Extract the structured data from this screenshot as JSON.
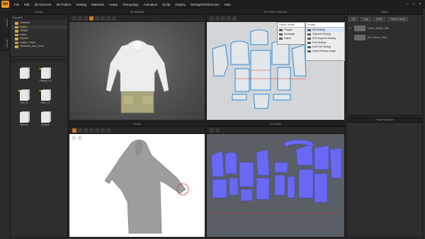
{
  "app": {
    "logo_text": "Md"
  },
  "menu": [
    "File",
    "Edit",
    "3D Garment",
    "2D Pattern",
    "Sewing",
    "Materials",
    "Avatar",
    "Retopology",
    "Animation",
    "Script",
    "Display",
    "Settings/Preferences",
    "Help"
  ],
  "window_controls": [
    "–",
    "□",
    "×"
  ],
  "left_tabs": [
    "Library",
    "History"
  ],
  "library": {
    "title": "Library",
    "favorites_label": "Favorites",
    "folders": [
      "Garment",
      "Avatar",
      "Hanger",
      "Fabric",
      "Eyelets",
      "Avatar_Poses",
      "hardware_and_Trims"
    ],
    "selected_index": 1,
    "files": [
      {
        "name": "",
        "starred": false
      },
      {
        "name": "Female_V2",
        "starred": true
      },
      {
        "name": "Rdt_V1",
        "starred": true
      },
      {
        "name": "Male_V2",
        "starred": true
      },
      {
        "name": "Woman",
        "starred": false
      },
      {
        "name": "Stickum",
        "starred": false
      }
    ]
  },
  "window_3d": {
    "title": "3D Window"
  },
  "window_2d": {
    "title": "2D Pattern Window",
    "dropdown_left": "Pattern Shape",
    "dropdown_right": "Sewing",
    "shape_menu": [
      "Polygon",
      "Rectangle",
      "Ellipse"
    ],
    "sewing_menu": [
      "Edit Sewing",
      "Segment Sewing",
      "M:N Segment Sewing",
      "Free Sewing",
      "M:N Free Sewing",
      "Check Sewing Length"
    ],
    "sewing_selected_index": 0
  },
  "fabric": {
    "title": "Fabric",
    "add_label": "Add",
    "copy_label": "Copy",
    "delete_label": "Delete",
    "delete_unused_label": "Delete Unused",
    "items": [
      {
        "name": "Cotton_Heavy_Twill",
        "checked": true
      },
      {
        "name": "Knit_Fleece_Terry",
        "checked": false
      }
    ]
  },
  "property_editor": {
    "title": "Property Editor"
  },
  "sculpt": {
    "title": "Sculpt"
  },
  "uv_editor": {
    "title": "UV Editor"
  },
  "colors": {
    "accent": "#f39a1e",
    "uv_piece": "#6a69f5",
    "selected_outline": "#e8322e"
  }
}
